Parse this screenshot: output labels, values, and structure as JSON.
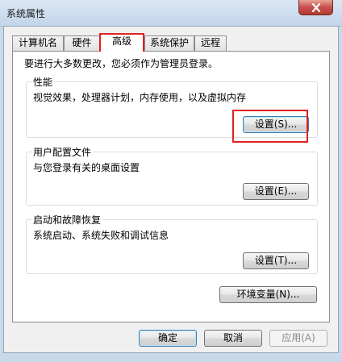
{
  "window": {
    "title": "系统属性"
  },
  "tabs": [
    {
      "label": "计算机名",
      "active": false
    },
    {
      "label": "硬件",
      "active": false
    },
    {
      "label": "高级",
      "active": true
    },
    {
      "label": "系统保护",
      "active": false
    },
    {
      "label": "远程",
      "active": false
    }
  ],
  "notice": "要进行大多数更改，您必须作为管理员登录。",
  "performance": {
    "title": "性能",
    "description": "视觉效果，处理器计划，内存使用，以及虚拟内存",
    "settings_label": "设置(S)..."
  },
  "user_profiles": {
    "title": "用户配置文件",
    "description": "与您登录有关的桌面设置",
    "settings_label": "设置(E)..."
  },
  "startup_recovery": {
    "title": "启动和故障恢复",
    "description": "系统启动、系统失败和调试信息",
    "settings_label": "设置(T)..."
  },
  "env_vars_label": "环境变量(N)...",
  "footer": {
    "ok_label": "确定",
    "cancel_label": "取消",
    "apply_label": "应用(A)"
  },
  "accent_colors": {
    "highlight": "#e02020",
    "close_button": "#c75050"
  }
}
